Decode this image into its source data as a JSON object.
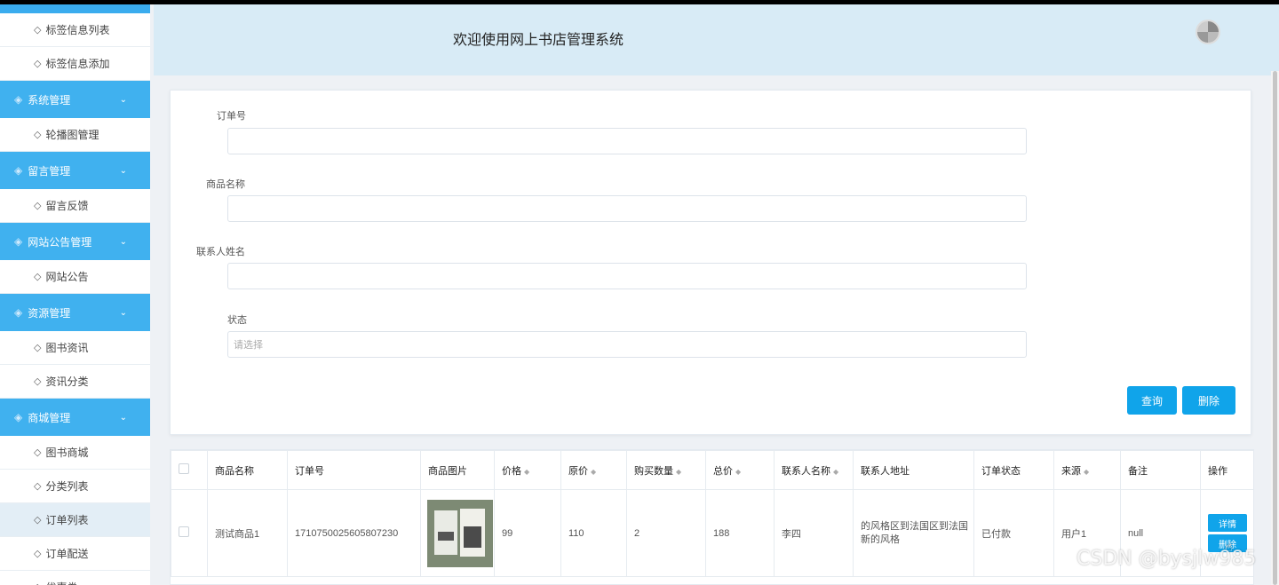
{
  "header": {
    "title": "欢迎使用网上书店管理系统"
  },
  "sidebar": {
    "items": [
      {
        "type": "sub",
        "label": "标签信息列表"
      },
      {
        "type": "sub",
        "label": "标签信息添加"
      },
      {
        "type": "group",
        "label": "系统管理"
      },
      {
        "type": "sub",
        "label": "轮播图管理"
      },
      {
        "type": "group",
        "label": "留言管理"
      },
      {
        "type": "sub",
        "label": "留言反馈"
      },
      {
        "type": "group",
        "label": "网站公告管理"
      },
      {
        "type": "sub",
        "label": "网站公告"
      },
      {
        "type": "group",
        "label": "资源管理"
      },
      {
        "type": "sub",
        "label": "图书资讯"
      },
      {
        "type": "sub",
        "label": "资讯分类"
      },
      {
        "type": "group",
        "label": "商城管理"
      },
      {
        "type": "sub",
        "label": "图书商城"
      },
      {
        "type": "sub",
        "label": "分类列表"
      },
      {
        "type": "sub",
        "label": "订单列表",
        "active": true
      },
      {
        "type": "sub",
        "label": "订单配送"
      },
      {
        "type": "sub",
        "label": "优惠券"
      }
    ]
  },
  "search": {
    "order_no_label": "订单号",
    "product_name_label": "商品名称",
    "contact_name_label": "联系人姓名",
    "status_label": "状态",
    "status_placeholder": "请选择",
    "query_button": "查询",
    "delete_button": "删除"
  },
  "table": {
    "headers": [
      "商品名称",
      "订单号",
      "商品图片",
      "价格",
      "原价",
      "购买数量",
      "总价",
      "联系人名称",
      "联系人地址",
      "订单状态",
      "来源",
      "备注",
      "操作"
    ],
    "rows": [
      {
        "product_name": "测试商品1",
        "order_no": "1710750025605807230",
        "price": "99",
        "original_price": "110",
        "quantity": "2",
        "total": "188",
        "contact_name": "李四",
        "contact_address": "的风格区到法国区到法国新的风格",
        "status": "已付款",
        "source": "用户1",
        "remark": "null",
        "detail_button": "详情",
        "delete_button": "删除"
      }
    ]
  },
  "watermark": "CSDN @bysjlw985"
}
